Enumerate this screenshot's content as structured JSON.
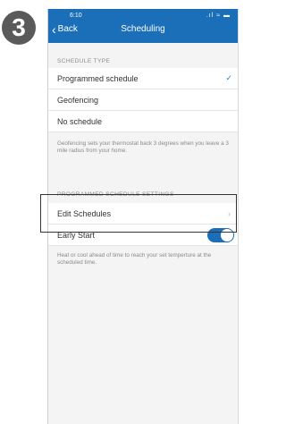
{
  "step_number": "3",
  "status_bar": {
    "time": "6:10",
    "icons": ".ıl ≈ ▬"
  },
  "navbar": {
    "back_label": "Back",
    "title": "Scheduling"
  },
  "schedule_type": {
    "header": "SCHEDULE TYPE",
    "options": [
      {
        "label": "Programmed schedule",
        "selected": true
      },
      {
        "label": "Geofencing",
        "selected": false
      },
      {
        "label": "No schedule",
        "selected": false
      }
    ],
    "footnote": "Geofencing sets your thermostat back 3 degrees when you leave a 3 mile radius from your home."
  },
  "programmed_settings": {
    "header": "PROGRAMMED SCHEDULE SETTINGS",
    "edit_schedules_label": "Edit Schedules",
    "early_start_label": "Early Start",
    "early_start_on": true,
    "footnote": "Heat or cool ahead of time to reach your set temperture at the scheduled time."
  },
  "colors": {
    "nav": "#1b6fb8",
    "check": "#2a7fd4"
  }
}
